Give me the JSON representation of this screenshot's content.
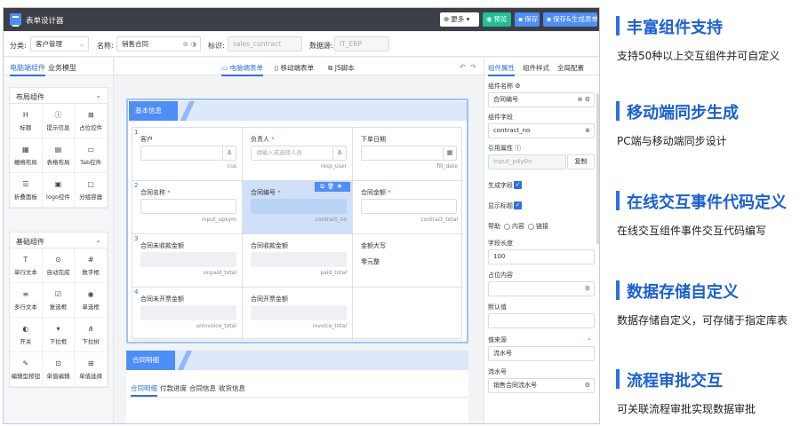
{
  "app": {
    "title": "表单设计器"
  },
  "toolbar": {
    "more": "更多",
    "preview": "预览",
    "save": "保存",
    "save_generate": "保存&生成表单"
  },
  "fieldbar": {
    "category_label": "分类:",
    "category_value": "客户管理",
    "name_label": "名称:",
    "name_value": "销售合同",
    "id_label": "标识:",
    "id_placeholder": "sales_contract",
    "source_label": "数据源:",
    "source_placeholder": "IT_ERP"
  },
  "left": {
    "tabs": [
      "电脑端组件",
      "业务模型"
    ],
    "groups": [
      {
        "title": "布局组件",
        "items": [
          {
            "label": "标题",
            "icon": "H"
          },
          {
            "label": "提示信息",
            "icon": "ⓘ"
          },
          {
            "label": "占位控件",
            "icon": "⊠"
          },
          {
            "label": "栅格布局",
            "icon": "▦"
          },
          {
            "label": "表格布局",
            "icon": "▤"
          },
          {
            "label": "Tab控件",
            "icon": "▭"
          },
          {
            "label": "折叠面板",
            "icon": "☰"
          },
          {
            "label": "logo控件",
            "icon": "▣"
          },
          {
            "label": "分组容器",
            "icon": "▢"
          }
        ]
      },
      {
        "title": "基础组件",
        "items": [
          {
            "label": "单行文本",
            "icon": "T"
          },
          {
            "label": "自动完成",
            "icon": "⊙"
          },
          {
            "label": "数字框",
            "icon": "#"
          },
          {
            "label": "多行文本",
            "icon": "≡"
          },
          {
            "label": "复选框",
            "icon": "☑"
          },
          {
            "label": "单选框",
            "icon": "◉"
          },
          {
            "label": "开关",
            "icon": "◐"
          },
          {
            "label": "下拉框",
            "icon": "▾"
          },
          {
            "label": "下拉树",
            "icon": "⋔"
          },
          {
            "label": "编辑型按钮",
            "icon": "✎"
          },
          {
            "label": "单值编辑",
            "icon": "⊡"
          },
          {
            "label": "单值选择",
            "icon": "⊞"
          }
        ]
      }
    ]
  },
  "center": {
    "tabs": [
      "电脑端表单",
      "移动端表单",
      "JS脚本"
    ],
    "section1_title": "基本信息",
    "rows": [
      {
        "num": "1",
        "cells": [
          {
            "label": "客户",
            "required": false,
            "placeholder": "",
            "key": "cus",
            "icon": "person"
          },
          {
            "label": "负责人",
            "required": true,
            "placeholder": "请输入或选择人员",
            "key": "resp_user",
            "icon": "person"
          },
          {
            "label": "下单日期",
            "required": false,
            "placeholder": "",
            "key": "fill_date",
            "icon": "calendar"
          }
        ]
      },
      {
        "num": "2",
        "cells": [
          {
            "label": "合同名称",
            "required": true,
            "placeholder": "",
            "key": "input_upxym"
          },
          {
            "label": "合同编号",
            "required": true,
            "placeholder": "",
            "key": "contract_no",
            "selected": true
          },
          {
            "label": "合同金额",
            "required": true,
            "placeholder": "",
            "key": "contract_total"
          }
        ]
      },
      {
        "num": "3",
        "cells": [
          {
            "label": "合同未收款金额",
            "required": false,
            "key": "unpaid_total",
            "gray": true
          },
          {
            "label": "合同收款金额",
            "required": false,
            "key": "paid_total",
            "gray": true
          },
          {
            "label": "金额大写",
            "required": false,
            "value": "零元整"
          }
        ]
      },
      {
        "num": "4",
        "cells": [
          {
            "label": "合同未开票金额",
            "required": false,
            "key": "uninvoice_total",
            "gray": true
          },
          {
            "label": "合同开票金额",
            "required": false,
            "key": "invoice_total",
            "gray": true
          },
          {
            "label": "",
            "required": false
          }
        ]
      }
    ],
    "section2_title": "合同明细",
    "subtabs": [
      "合同明细",
      "付款进度",
      "合同信息",
      "收货信息"
    ]
  },
  "right": {
    "tabs": [
      "组件属性",
      "组件样式",
      "全局配置"
    ],
    "component_name_label": "组件名称",
    "component_name_value": "合同编号",
    "field_label": "组件字段",
    "field_value": "contract_no",
    "ref_label": "引用属性",
    "ref_value": "input_p4y0n",
    "copy": "复制",
    "gen_field_label": "生成字段",
    "show_title_label": "显示标题",
    "help_label": "帮助",
    "help_opt1": "内容",
    "help_opt2": "链接",
    "length_label": "字段长度",
    "length_value": "100",
    "placeholder_label": "占位内容",
    "default_label": "默认值",
    "value_source_label": "值来源",
    "value_source_value": "流水号",
    "serial_label": "流水号",
    "serial_value": "销售合同流水号"
  },
  "features": [
    {
      "title": "丰富组件支持",
      "desc": "支持50种以上交互组件并可自定义"
    },
    {
      "title": "移动端同步生成",
      "desc": "PC端与移动端同步设计"
    },
    {
      "title": "在线交互事件代码定义",
      "desc": "在线交互组件事件交互代码编写"
    },
    {
      "title": "数据存储自定义",
      "desc": "数据存储自定义，可存储于指定库表"
    },
    {
      "title": "流程审批交互",
      "desc": "可关联流程审批实现数据审批"
    }
  ]
}
